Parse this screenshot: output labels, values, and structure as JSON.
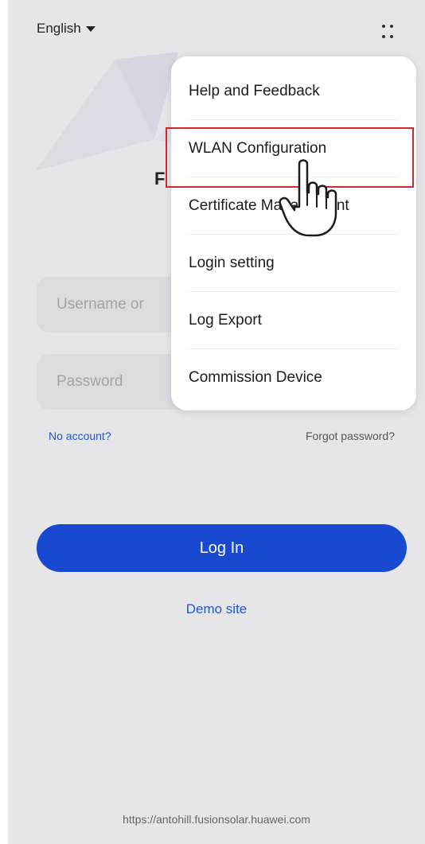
{
  "topbar": {
    "language": "English",
    "more_icon": "grid-dots-icon"
  },
  "login": {
    "title_partial": "F",
    "username_placeholder": "Username or",
    "password_placeholder": "Password",
    "no_account": "No account?",
    "forgot_password": "Forgot password?",
    "login_button": "Log In",
    "demo_site": "Demo site",
    "footer_url": "https://antohill.fusionsolar.huawei.com"
  },
  "menu": {
    "items": [
      {
        "label": "Help and Feedback"
      },
      {
        "label": "WLAN Configuration"
      },
      {
        "label": "Certificate Management"
      },
      {
        "label": "Login setting"
      },
      {
        "label": "Log Export"
      },
      {
        "label": "Commission Device"
      }
    ],
    "highlight_color": "#d1272e"
  },
  "colors": {
    "accent": "#1a49d1",
    "link": "#2456c9",
    "background": "#e6e5e8"
  }
}
